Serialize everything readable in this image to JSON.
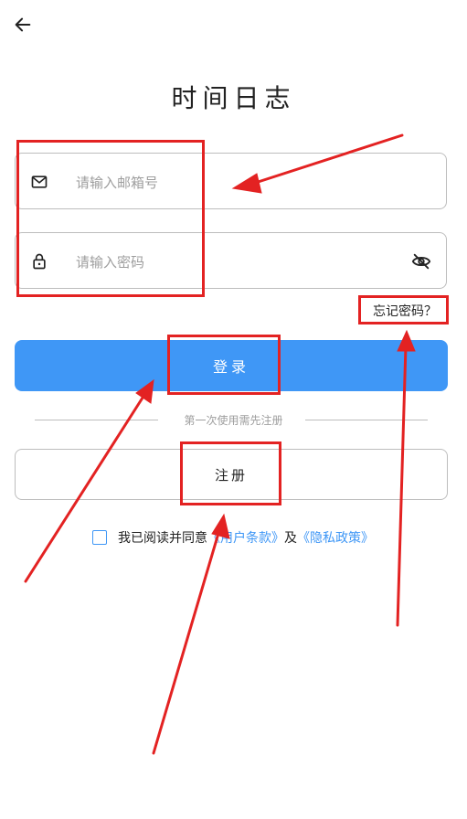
{
  "header": {
    "back_icon": "arrow-left-icon"
  },
  "app": {
    "title": "时间日志"
  },
  "email_field": {
    "icon": "mail-icon",
    "placeholder": "请输入邮箱号",
    "value": ""
  },
  "password_field": {
    "icon": "lock-icon",
    "placeholder": "请输入密码",
    "value": "",
    "toggle_icon": "eye-off-icon"
  },
  "forgot": {
    "label": "忘记密码？"
  },
  "login": {
    "label": "登录"
  },
  "divider": {
    "text": "第一次使用需先注册"
  },
  "register": {
    "label": "注册"
  },
  "agreement": {
    "checked": false,
    "prefix": "我已阅读并同意",
    "terms": "《用户条款》",
    "conjunction": "及",
    "privacy": "《隐私政策》"
  },
  "colors": {
    "primary": "#3f97f6",
    "annotation": "#e32222",
    "border": "#bdbdbd"
  }
}
